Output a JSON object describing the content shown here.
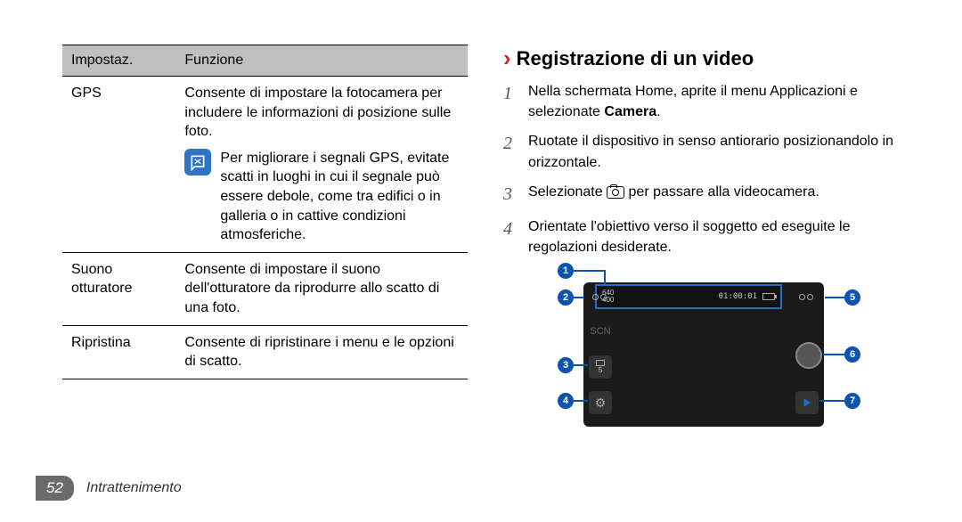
{
  "table": {
    "header": {
      "col1": "Impostaz.",
      "col2": "Funzione"
    },
    "rows": [
      {
        "label": "GPS",
        "text": "Consente di impostare la fotocamera per includere le informazioni di posizione sulle foto.",
        "note": "Per migliorare i segnali GPS, evitate scatti in luoghi in cui il segnale può essere debole, come tra edifici o in galleria o in cattive condizioni atmosferiche."
      },
      {
        "label": "Suono otturatore",
        "text": "Consente di impostare il suono dell'otturatore da riprodurre allo scatto di una foto."
      },
      {
        "label": "Ripristina",
        "text": "Consente di ripristinare i menu e le opzioni di scatto."
      }
    ]
  },
  "section": {
    "title": "Registrazione di un video",
    "steps": [
      {
        "n": "1",
        "pre": "Nella schermata Home, aprite il menu Applicazioni e selezionate ",
        "bold": "Camera",
        "post": "."
      },
      {
        "n": "2",
        "text": "Ruotate il dispositivo in senso antiorario posizionandolo in orizzontale."
      },
      {
        "n": "3",
        "pre": "Selezionate ",
        "icon": "camera-icon",
        "post": " per passare alla videocamera."
      },
      {
        "n": "4",
        "text": "Orientate l'obiettivo verso il soggetto ed eseguite le regolazioni desiderate."
      }
    ]
  },
  "diagram": {
    "callouts": {
      "c1": "1",
      "c2": "2",
      "c3": "3",
      "c4": "4",
      "c5": "5",
      "c6": "6",
      "c7": "7"
    },
    "topbar": {
      "res1": "640",
      "res2": "400",
      "time": "01:00:01"
    },
    "side_left": {
      "scn": "SCN",
      "timer_val": "5"
    },
    "icons": {
      "flash": "flash-icon",
      "scene": "scene-mode-icon",
      "timer": "timer-icon",
      "settings": "settings-gear-icon",
      "switch": "camera-switch-icon",
      "record": "record-button-icon",
      "play": "play-icon",
      "battery": "battery-icon"
    }
  },
  "footer": {
    "page": "52",
    "label": "Intrattenimento"
  }
}
